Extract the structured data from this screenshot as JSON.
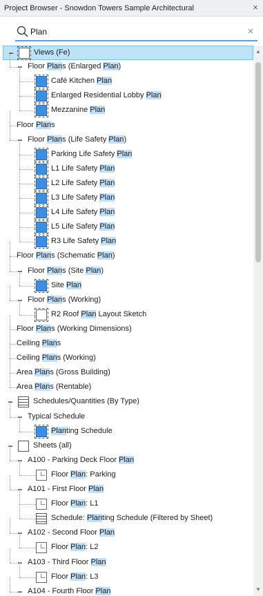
{
  "window": {
    "title": "Project Browser - Snowdon Towers Sample Architectural",
    "close_label": "×"
  },
  "search": {
    "value": "Plan",
    "clear_label": "×"
  },
  "highlight": "Plan",
  "tree": [
    {
      "depth": 0,
      "toggle": "−",
      "icon": "views",
      "text": "Views (Fe)",
      "selected": true
    },
    {
      "depth": 1,
      "toggle": "−",
      "icon": "",
      "text": "Floor Plans (Enlarged Plan)"
    },
    {
      "depth": 2,
      "toggle": "",
      "icon": "view",
      "text": "Café Kitchen Plan"
    },
    {
      "depth": 2,
      "toggle": "",
      "icon": "view",
      "text": "Enlarged Residential Lobby Plan"
    },
    {
      "depth": 2,
      "toggle": "",
      "icon": "view",
      "text": "Mezzanine Plan"
    },
    {
      "depth": 1,
      "toggle": "",
      "icon": "",
      "text": "Floor Plans"
    },
    {
      "depth": 1,
      "toggle": "−",
      "icon": "",
      "text": "Floor Plans (Life Safety Plan)"
    },
    {
      "depth": 2,
      "toggle": "",
      "icon": "view",
      "text": "Parking Life Safety Plan"
    },
    {
      "depth": 2,
      "toggle": "",
      "icon": "view",
      "text": "L1 Life Safety Plan"
    },
    {
      "depth": 2,
      "toggle": "",
      "icon": "view",
      "text": "L2 Life Safety Plan"
    },
    {
      "depth": 2,
      "toggle": "",
      "icon": "view",
      "text": "L3 Life Safety Plan"
    },
    {
      "depth": 2,
      "toggle": "",
      "icon": "view",
      "text": "L4 Life Safety Plan"
    },
    {
      "depth": 2,
      "toggle": "",
      "icon": "view",
      "text": "L5 Life Safety Plan"
    },
    {
      "depth": 2,
      "toggle": "",
      "icon": "view",
      "text": "R3 Life Safety Plan"
    },
    {
      "depth": 1,
      "toggle": "",
      "icon": "",
      "text": "Floor Plans (Schematic Plan)"
    },
    {
      "depth": 1,
      "toggle": "−",
      "icon": "",
      "text": "Floor Plans (Site Plan)"
    },
    {
      "depth": 2,
      "toggle": "",
      "icon": "view",
      "text": "Site Plan"
    },
    {
      "depth": 1,
      "toggle": "−",
      "icon": "",
      "text": "Floor Plans (Working)"
    },
    {
      "depth": 2,
      "toggle": "",
      "icon": "viewline",
      "text": "R2 Roof Plan Layout Sketch"
    },
    {
      "depth": 1,
      "toggle": "",
      "icon": "",
      "text": "Floor Plans (Working Dimensions)"
    },
    {
      "depth": 1,
      "toggle": "",
      "icon": "",
      "text": "Ceiling Plans"
    },
    {
      "depth": 1,
      "toggle": "",
      "icon": "",
      "text": "Ceiling Plans (Working)"
    },
    {
      "depth": 1,
      "toggle": "",
      "icon": "",
      "text": "Area Plans (Gross Building)"
    },
    {
      "depth": 1,
      "toggle": "",
      "icon": "",
      "text": "Area Plans (Rentable)"
    },
    {
      "depth": 0,
      "toggle": "−",
      "icon": "sched",
      "text": "Schedules/Quantities (By Type)"
    },
    {
      "depth": 1,
      "toggle": "−",
      "icon": "",
      "text": "Typical Schedule"
    },
    {
      "depth": 2,
      "toggle": "",
      "icon": "view",
      "text": "Planting Schedule"
    },
    {
      "depth": 0,
      "toggle": "−",
      "icon": "folder",
      "text": "Sheets (all)"
    },
    {
      "depth": 1,
      "toggle": "−",
      "icon": "",
      "text": "A100 - Parking Deck Floor Plan"
    },
    {
      "depth": 2,
      "toggle": "",
      "icon": "sheet",
      "text": "Floor Plan: Parking"
    },
    {
      "depth": 1,
      "toggle": "−",
      "icon": "",
      "text": "A101 - First Floor Plan"
    },
    {
      "depth": 2,
      "toggle": "",
      "icon": "sheet",
      "text": "Floor Plan: L1"
    },
    {
      "depth": 2,
      "toggle": "",
      "icon": "sched",
      "text": "Schedule: Planting Schedule (Filtered by Sheet)"
    },
    {
      "depth": 1,
      "toggle": "−",
      "icon": "",
      "text": "A102 - Second Floor Plan"
    },
    {
      "depth": 2,
      "toggle": "",
      "icon": "sheet",
      "text": "Floor Plan: L2"
    },
    {
      "depth": 1,
      "toggle": "−",
      "icon": "",
      "text": "A103 - Third Floor Plan"
    },
    {
      "depth": 2,
      "toggle": "",
      "icon": "sheet",
      "text": "Floor Plan: L3"
    },
    {
      "depth": 1,
      "toggle": "−",
      "icon": "",
      "text": "A104 - Fourth Floor Plan"
    }
  ]
}
